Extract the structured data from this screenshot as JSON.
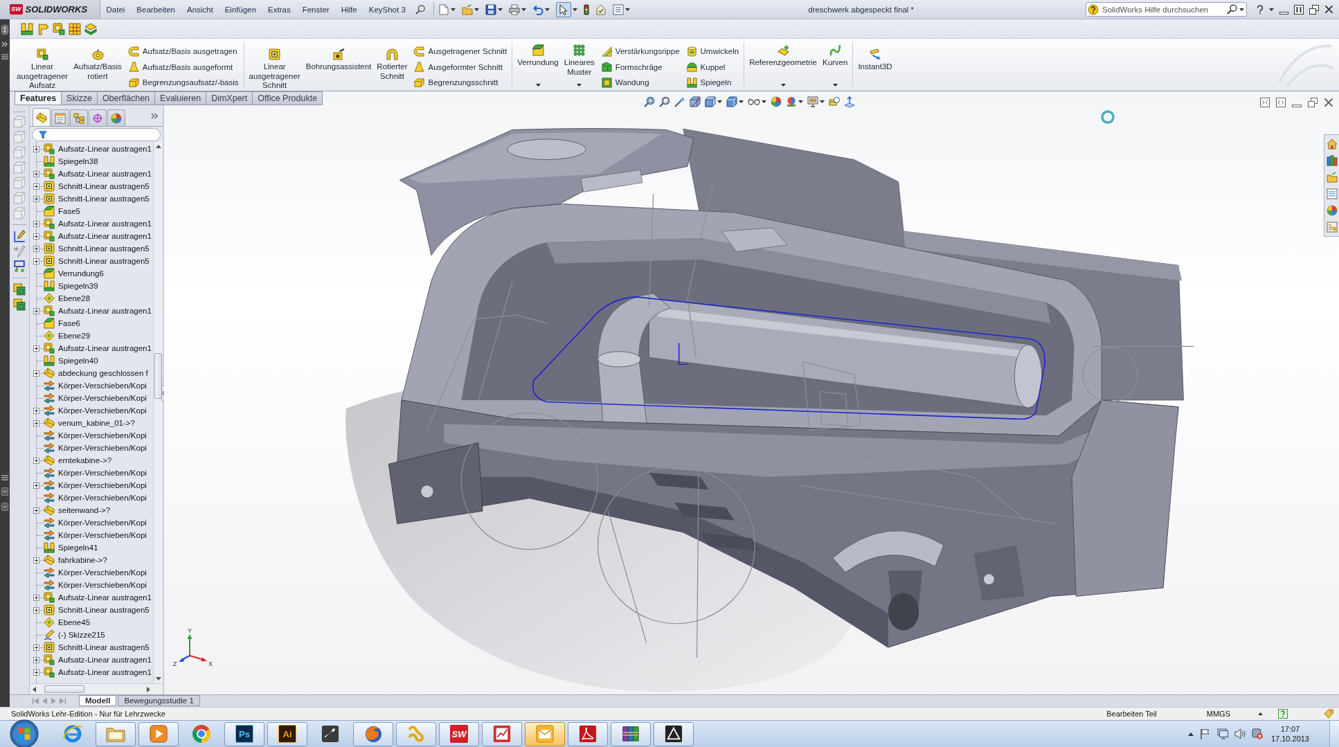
{
  "title_bar": {
    "logo": {
      "badge": "SW",
      "wordmark": "SOLIDWORKS"
    },
    "menu": [
      "Datei",
      "Bearbeiten",
      "Ansicht",
      "Einfügen",
      "Extras",
      "Fenster",
      "Hilfe",
      "KeyShot 3"
    ],
    "quick_tools": [
      {
        "pressed": false
      },
      {
        "pressed": false
      },
      {
        "pressed": false
      },
      {
        "pressed": false
      },
      {
        "pressed": false
      },
      {
        "pressed": true
      },
      {
        "pressed": false
      },
      {
        "pressed": false
      },
      {
        "pressed": false
      }
    ],
    "document_title": "dreschwerk abgespeckt final *",
    "help_search": {
      "placeholder": "SolidWorks Hilfe durchsuchen"
    }
  },
  "ribbon": {
    "groups": [
      {
        "large": [
          {
            "label": "Linear\nausgetragener\nAufsatz",
            "dropdown": false
          },
          {
            "label": "Aufsatz/Basis\nrotiert",
            "dropdown": false
          }
        ],
        "columns": [
          [
            "Aufsatz/Basis ausgetragen",
            "Aufsatz/Basis ausgeformt",
            "Begrenzungsaufsatz/-basis"
          ]
        ]
      },
      {
        "large": [
          {
            "label": "Linear\nausgetragener\nSchnitt",
            "dropdown": false
          },
          {
            "label": "Bohrungsassistent",
            "dropdown": false
          },
          {
            "label": "Rotierter\nSchnitt",
            "dropdown": false
          }
        ],
        "columns": [
          [
            "Ausgetragener Schnitt",
            "Ausgeformter Schnitt",
            "Begrenzungsschnitt"
          ]
        ]
      },
      {
        "large": [
          {
            "label": "Verrundung",
            "dropdown": true
          },
          {
            "label": "Lineares\nMuster",
            "dropdown": true
          }
        ],
        "columns": [
          [
            "Verstärkungsrippe",
            "Formschräge",
            "Wandung"
          ],
          [
            "Umwickeln",
            "Kuppel",
            "Spiegeln"
          ]
        ]
      },
      {
        "large": [
          {
            "label": "Referenzgeometrie",
            "dropdown": true
          },
          {
            "label": "Kurven",
            "dropdown": true
          }
        ]
      },
      {
        "large": [
          {
            "label": "Instant3D",
            "dropdown": false
          }
        ]
      }
    ]
  },
  "command_tabs": [
    {
      "label": "Features",
      "selected": true
    },
    {
      "label": "Skizze",
      "selected": false
    },
    {
      "label": "Oberflächen",
      "selected": false
    },
    {
      "label": "Evaluieren",
      "selected": false
    },
    {
      "label": "DimXpert",
      "selected": false
    },
    {
      "label": "Office Produkte",
      "selected": false
    }
  ],
  "side_toolbar": [
    {
      "disabled": true
    },
    {
      "disabled": true
    },
    {
      "disabled": true
    },
    {
      "disabled": true
    },
    {
      "disabled": true
    },
    {
      "disabled": true
    },
    {
      "disabled": true
    },
    {
      "disabled": false
    },
    {
      "disabled": true
    },
    {
      "disabled": false
    },
    {
      "disabled": false
    },
    {
      "disabled": false
    }
  ],
  "feature_manager": {
    "tabs": [
      {
        "selected": true
      },
      {
        "selected": false
      },
      {
        "selected": false
      },
      {
        "selected": false
      },
      {
        "selected": false
      }
    ],
    "items": [
      {
        "label": "Aufsatz-Linear austragen1",
        "kind": "boss",
        "expandable": true
      },
      {
        "label": "Spiegeln38",
        "kind": "mirror",
        "expandable": false
      },
      {
        "label": "Aufsatz-Linear austragen1",
        "kind": "boss",
        "expandable": true
      },
      {
        "label": "Schnitt-Linear austragen5",
        "kind": "cut",
        "expandable": true
      },
      {
        "label": "Schnitt-Linear austragen5",
        "kind": "cut",
        "expandable": true
      },
      {
        "label": "Fase5",
        "kind": "chamfer",
        "expandable": false
      },
      {
        "label": "Aufsatz-Linear austragen1",
        "kind": "boss",
        "expandable": true
      },
      {
        "label": "Aufsatz-Linear austragen1",
        "kind": "boss",
        "expandable": true
      },
      {
        "label": "Schnitt-Linear austragen5",
        "kind": "cut",
        "expandable": true
      },
      {
        "label": "Schnitt-Linear austragen5",
        "kind": "cut",
        "expandable": true
      },
      {
        "label": "Verrundung6",
        "kind": "fillet",
        "expandable": false
      },
      {
        "label": "Spiegeln39",
        "kind": "mirror",
        "expandable": false
      },
      {
        "label": "Ebene28",
        "kind": "plane",
        "expandable": false
      },
      {
        "label": "Aufsatz-Linear austragen1",
        "kind": "boss",
        "expandable": true
      },
      {
        "label": "Fase6",
        "kind": "chamfer",
        "expandable": false
      },
      {
        "label": "Ebene29",
        "kind": "plane",
        "expandable": false
      },
      {
        "label": "Aufsatz-Linear austragen1",
        "kind": "boss",
        "expandable": true
      },
      {
        "label": "Spiegeln40",
        "kind": "mirror",
        "expandable": false
      },
      {
        "label": "abdeckung geschlossen f",
        "kind": "body",
        "expandable": true
      },
      {
        "label": "Körper-Verschieben/Kopi",
        "kind": "move",
        "expandable": false
      },
      {
        "label": "Körper-Verschieben/Kopi",
        "kind": "move",
        "expandable": false
      },
      {
        "label": "Körper-Verschieben/Kopi",
        "kind": "move",
        "expandable": true
      },
      {
        "label": "venum_kabine_01->?",
        "kind": "body",
        "expandable": true
      },
      {
        "label": "Körper-Verschieben/Kopi",
        "kind": "move",
        "expandable": false
      },
      {
        "label": "Körper-Verschieben/Kopi",
        "kind": "move",
        "expandable": false
      },
      {
        "label": "erntekabine->?",
        "kind": "body",
        "expandable": true
      },
      {
        "label": "Körper-Verschieben/Kopi",
        "kind": "move",
        "expandable": false
      },
      {
        "label": "Körper-Verschieben/Kopi",
        "kind": "move",
        "expandable": true
      },
      {
        "label": "Körper-Verschieben/Kopi",
        "kind": "move",
        "expandable": false
      },
      {
        "label": "seitenwand->?",
        "kind": "body",
        "expandable": true
      },
      {
        "label": "Körper-Verschieben/Kopi",
        "kind": "move",
        "expandable": false
      },
      {
        "label": "Körper-Verschieben/Kopi",
        "kind": "move",
        "expandable": false
      },
      {
        "label": "Spiegeln41",
        "kind": "mirror",
        "expandable": false
      },
      {
        "label": "fahrkabine->?",
        "kind": "body",
        "expandable": true
      },
      {
        "label": "Körper-Verschieben/Kopi",
        "kind": "move",
        "expandable": false
      },
      {
        "label": "Körper-Verschieben/Kopi",
        "kind": "move",
        "expandable": false
      },
      {
        "label": "Aufsatz-Linear austragen1",
        "kind": "boss",
        "expandable": true
      },
      {
        "label": "Schnitt-Linear austragen5",
        "kind": "cut",
        "expandable": true
      },
      {
        "label": "Ebene45",
        "kind": "plane",
        "expandable": false
      },
      {
        "label": "(-) Skizze215",
        "kind": "sketch",
        "expandable": false
      },
      {
        "label": "Schnitt-Linear austragen5",
        "kind": "cut",
        "expandable": true
      },
      {
        "label": "Aufsatz-Linear austragen1",
        "kind": "boss",
        "expandable": true
      },
      {
        "label": "Aufsatz-Linear austragen1",
        "kind": "boss",
        "expandable": true
      }
    ]
  },
  "viewport": {
    "triad": {
      "x": "X",
      "y": "Y",
      "z": "Z"
    }
  },
  "bottom_bar": {
    "nav": [
      {
        "disabled": true
      },
      {
        "disabled": true
      },
      {
        "disabled": true
      },
      {
        "disabled": true
      }
    ],
    "tabs": [
      {
        "label": "Modell",
        "selected": true
      },
      {
        "label": "Bewegungsstudie 1",
        "selected": false
      }
    ]
  },
  "status_bar": {
    "message": "SolidWorks Lehr-Edition - Nur für Lehrzwecke",
    "mode": "Bearbeiten Teil",
    "units": "MMGS"
  },
  "taskbar": {
    "apps": [
      {
        "kind": "icon",
        "running": false,
        "highlighted": false
      },
      {
        "kind": "icon",
        "running": true,
        "highlighted": false
      },
      {
        "kind": "icon",
        "running": true,
        "highlighted": false
      },
      {
        "kind": "icon",
        "running": false,
        "highlighted": false
      },
      {
        "kind": "tile",
        "label": "Ps",
        "running": true,
        "highlighted": false
      },
      {
        "kind": "tile",
        "label": "Ai",
        "running": true,
        "highlighted": false
      },
      {
        "kind": "icon",
        "running": false,
        "highlighted": false
      },
      {
        "kind": "icon",
        "running": true,
        "highlighted": false
      },
      {
        "kind": "icon",
        "running": true,
        "highlighted": false
      },
      {
        "kind": "tile",
        "label": "SW",
        "running": true,
        "highlighted": false
      },
      {
        "kind": "icon",
        "running": true,
        "highlighted": false
      },
      {
        "kind": "icon",
        "running": true,
        "highlighted": true
      },
      {
        "kind": "icon",
        "running": true,
        "highlighted": false
      },
      {
        "kind": "icon",
        "running": true,
        "highlighted": false
      },
      {
        "kind": "icon",
        "running": true,
        "highlighted": false
      }
    ],
    "clock": {
      "time": "17:07",
      "date": "17.10.2013"
    }
  }
}
